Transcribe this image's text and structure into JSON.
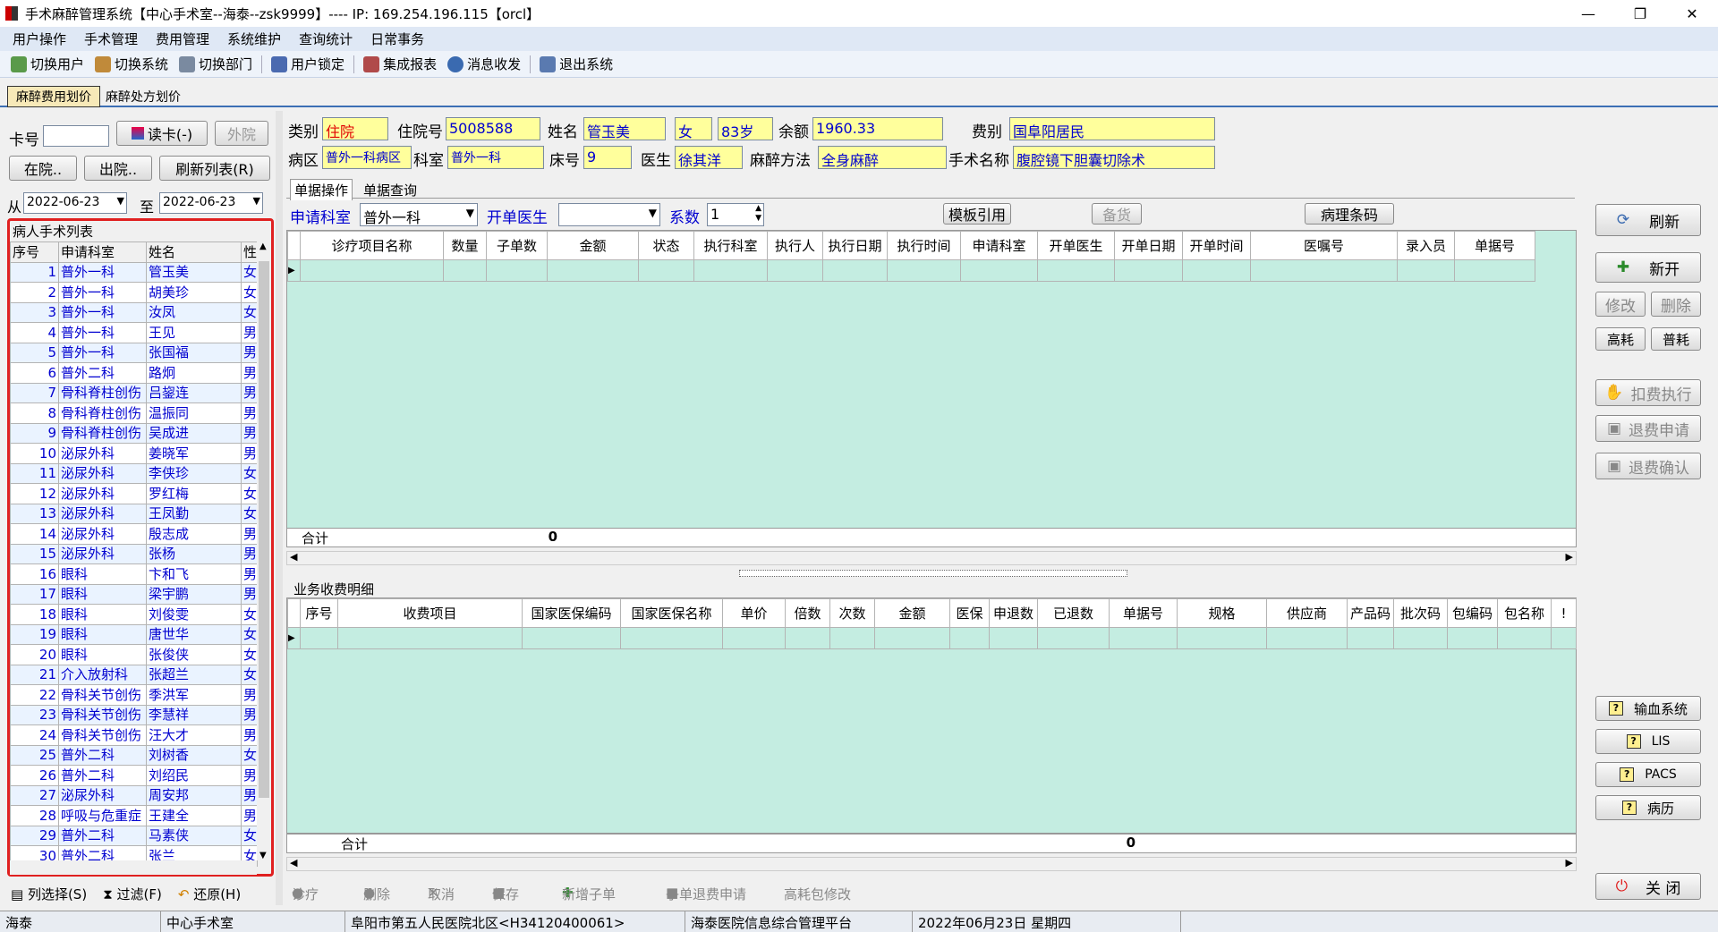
{
  "window": {
    "title": "手术麻醉管理系统【中心手术室--海泰--zsk9999】---- IP: 169.254.196.115【orcl】",
    "min": "—",
    "restore": "❐",
    "close": "✕"
  },
  "menu": [
    "用户操作",
    "手术管理",
    "费用管理",
    "系统维护",
    "查询统计",
    "日常事务"
  ],
  "toolbar": [
    {
      "label": "切换用户",
      "icon": "switch-user-icon"
    },
    {
      "label": "切换系统",
      "icon": "switch-system-icon"
    },
    {
      "label": "切换部门",
      "icon": "switch-dept-icon"
    },
    {
      "label": "用户锁定",
      "icon": "lock-user-icon"
    },
    {
      "label": "集成报表",
      "icon": "report-icon"
    },
    {
      "label": "消息收发",
      "icon": "info-icon"
    },
    {
      "label": "退出系统",
      "icon": "exit-icon"
    }
  ],
  "tabs": {
    "active": "麻醉费用划价",
    "other": "麻醉处方划价"
  },
  "left": {
    "card_label": "卡号",
    "read_card": "读卡(-)",
    "outpatient": "外院",
    "in_hospital": "在院..",
    "out_hospital": "出院..",
    "refresh_list": "刷新列表(R)",
    "from_label": "从",
    "from_date": "2022-06-23",
    "to_label": "至",
    "to_date": "2022-06-23",
    "list_title": "病人手术列表",
    "columns": [
      "序号",
      "申请科室",
      "姓名",
      "性"
    ],
    "rows": [
      [
        "1",
        "普外一科",
        "管玉美",
        "女"
      ],
      [
        "2",
        "普外一科",
        "胡美珍",
        "女"
      ],
      [
        "3",
        "普外一科",
        "汝凤",
        "女"
      ],
      [
        "4",
        "普外一科",
        "王见",
        "男"
      ],
      [
        "5",
        "普外一科",
        "张国福",
        "男"
      ],
      [
        "6",
        "普外二科",
        "路炯",
        "男"
      ],
      [
        "7",
        "骨科脊柱创伤",
        "吕鋆连",
        "男"
      ],
      [
        "8",
        "骨科脊柱创伤",
        "温振同",
        "男"
      ],
      [
        "9",
        "骨科脊柱创伤",
        "吴成进",
        "男"
      ],
      [
        "10",
        "泌尿外科",
        "姜晓军",
        "男"
      ],
      [
        "11",
        "泌尿外科",
        "李侠珍",
        "女"
      ],
      [
        "12",
        "泌尿外科",
        "罗红梅",
        "女"
      ],
      [
        "13",
        "泌尿外科",
        "王凤勤",
        "女"
      ],
      [
        "14",
        "泌尿外科",
        "殷志成",
        "男"
      ],
      [
        "15",
        "泌尿外科",
        "张杨",
        "男"
      ],
      [
        "16",
        "眼科",
        "卞和飞",
        "男"
      ],
      [
        "17",
        "眼科",
        "梁宇鹏",
        "男"
      ],
      [
        "18",
        "眼科",
        "刘俊雯",
        "女"
      ],
      [
        "19",
        "眼科",
        "唐世华",
        "女"
      ],
      [
        "20",
        "眼科",
        "张俊侠",
        "女"
      ],
      [
        "21",
        "介入放射科",
        "张超兰",
        "女"
      ],
      [
        "22",
        "骨科关节创伤",
        "季洪军",
        "男"
      ],
      [
        "23",
        "骨科关节创伤",
        "李慧祥",
        "男"
      ],
      [
        "24",
        "骨科关节创伤",
        "汪大才",
        "男"
      ],
      [
        "25",
        "普外二科",
        "刘树香",
        "女"
      ],
      [
        "26",
        "普外二科",
        "刘绍民",
        "男"
      ],
      [
        "27",
        "泌尿外科",
        "周安邦",
        "男"
      ],
      [
        "28",
        "呼吸与危重症",
        "王建全",
        "男"
      ],
      [
        "29",
        "普外二科",
        "马素侠",
        "女"
      ],
      [
        "30",
        "普外二科",
        "张兰",
        "女"
      ]
    ],
    "footer": {
      "col_select": "列选择(S)",
      "filter": "过滤(F)",
      "restore": "还原(H)"
    }
  },
  "patient": {
    "type_label": "类别",
    "type": "住院",
    "inpatient_no_label": "住院号",
    "inpatient_no": "5008588",
    "name_label": "姓名",
    "name": "管玉美",
    "sex": "女",
    "age": "83岁",
    "balance_label": "余额",
    "balance": "1960.33",
    "fee_type_label": "费别",
    "fee_type": "国阜阳居民",
    "ward_label": "病区",
    "ward": "普外一科病区",
    "dept_label": "科室",
    "dept": "普外一科",
    "bed_label": "床号",
    "bed": "9",
    "doctor_label": "医生",
    "doctor": "徐其洋",
    "anes_label": "麻醉方法",
    "anes": "全身麻醉",
    "surgery_label": "手术名称",
    "surgery": "腹腔镜下胆囊切除术"
  },
  "subtabs": {
    "active": "单据操作",
    "other": "单据查询"
  },
  "order_bar": {
    "dept_label": "申请科室",
    "dept": "普外一科",
    "doctor_label": "开单医生",
    "doctor": "",
    "coef_label": "系数",
    "coef": "1",
    "template": "模板引用",
    "backup": "备货",
    "pathology": "病理条码"
  },
  "grid1": {
    "columns": [
      "诊疗项目名称",
      "数量",
      "子单数",
      "金额",
      "状态",
      "执行科室",
      "执行人",
      "执行日期",
      "执行时间",
      "申请科室",
      "开单医生",
      "开单日期",
      "开单时间",
      "医嘱号",
      "录入员",
      "单据号"
    ],
    "sum_label": "合计",
    "sum_value": "0"
  },
  "grid2": {
    "title": "业务收费明细",
    "columns": [
      "序号",
      "收费项目",
      "国家医保编码",
      "国家医保名称",
      "单价",
      "倍数",
      "次数",
      "金额",
      "医保",
      "申退数",
      "已退数",
      "单据号",
      "规格",
      "供应商",
      "产品码",
      "批次码",
      "包编码",
      "包名称",
      "!"
    ],
    "sum_label": "合计",
    "sum_value": "0"
  },
  "bottom_tools": {
    "diag": "诊疗",
    "delete": "删除",
    "cancel": "取消",
    "save": "保存",
    "add_sub": "新增子单",
    "refund_apply": "子单退费申请",
    "pkg_edit": "高耗包修改"
  },
  "side": {
    "refresh": "刷新",
    "new": "新开",
    "modify": "修改",
    "delete": "删除",
    "high": "高耗",
    "normal": "普耗",
    "charge": "扣费执行",
    "refund_req": "退费申请",
    "refund_ok": "退费确认",
    "blood": "输血系统",
    "lis": "LIS",
    "pacs": "PACS",
    "record": "病历",
    "close": "关 闭"
  },
  "status": [
    "海泰",
    "中心手术室",
    "阜阳市第五人民医院北区<H34120400061>",
    "海泰医院信息综合管理平台",
    "2022年06月23日 星期四"
  ]
}
